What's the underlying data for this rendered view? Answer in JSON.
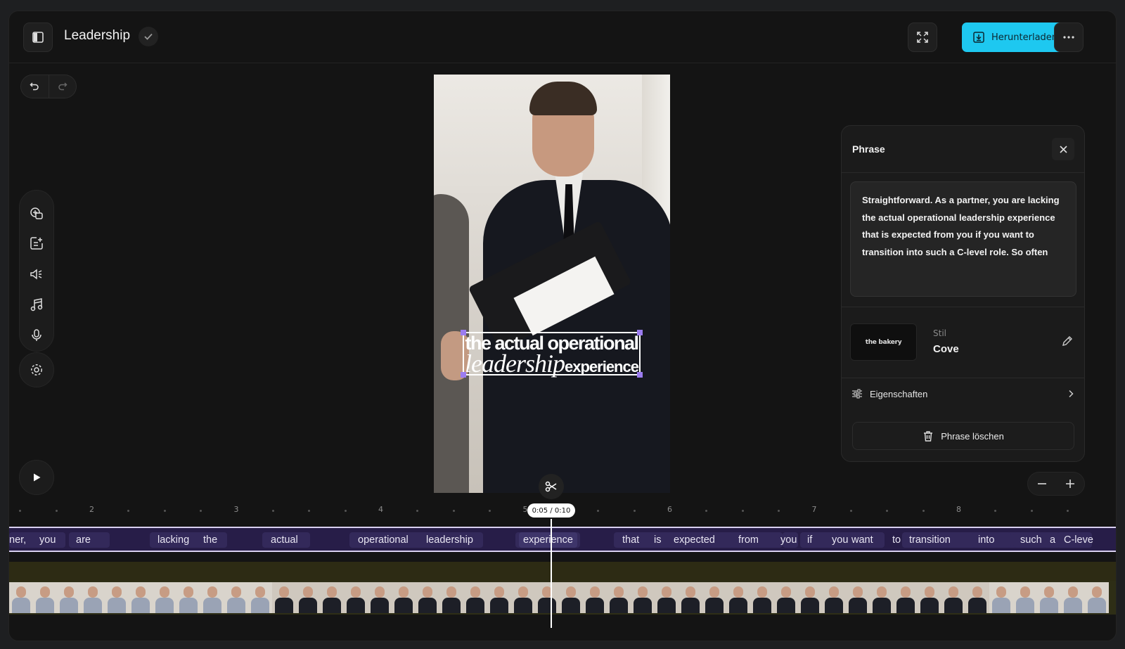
{
  "header": {
    "title": "Leadership",
    "download_label": "Herunterladen"
  },
  "panel": {
    "title": "Phrase",
    "phrase_text": "Straightforward. As a partner, you are lacking the actual operational leadership experience that is expected from you if you want to transition into such a C-level role. So often",
    "style_label": "Stil",
    "style_name": "Cove",
    "style_thumb_text": "the bakery",
    "properties_label": "Eigenschaften",
    "delete_label": "Phrase löschen"
  },
  "caption": {
    "line1": "the actual operational",
    "line2_script": "leadership",
    "line2_bold": "experience"
  },
  "timeline": {
    "time_display": "0:05 / 0:10",
    "ruler_labels": [
      "2",
      "3",
      "4",
      "5",
      "6",
      "7",
      "8"
    ],
    "words": [
      "ner,",
      "you",
      "are",
      "lacking",
      "the",
      "actual",
      "operational",
      "leadership",
      "experience",
      "that",
      "is",
      "expected",
      "from",
      "you",
      "if",
      "you",
      "want",
      "to",
      "transition",
      "into",
      "such",
      "a",
      "C-leve"
    ],
    "selected_word": "experience"
  },
  "icons": [
    "sidebar-toggle-icon",
    "check-icon",
    "fullscreen-icon",
    "download-icon",
    "more-icon",
    "undo-icon",
    "redo-icon",
    "add-media-icon",
    "add-text-icon",
    "audio-icon",
    "music-icon",
    "microphone-icon",
    "settings-icon",
    "play-icon",
    "scissors-icon",
    "close-icon",
    "edit-icon",
    "sliders-icon",
    "chevron-right-icon",
    "trash-icon",
    "zoom-out-icon",
    "zoom-in-icon"
  ],
  "colors": {
    "accent": "#1ec8f0",
    "word_track": "#271d48",
    "selection_handles": "#9b7cf0"
  }
}
